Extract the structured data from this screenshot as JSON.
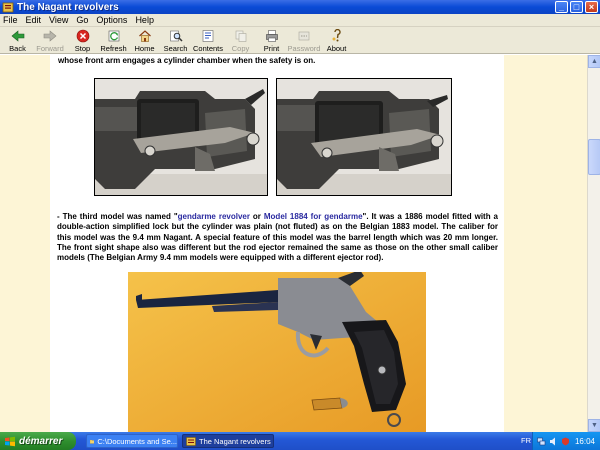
{
  "window": {
    "title": "The Nagant revolvers"
  },
  "menu": [
    "File",
    "Edit",
    "View",
    "Go",
    "Options",
    "Help"
  ],
  "toolbar": [
    {
      "label": "Back",
      "icon": "back-arrow-icon",
      "enabled": true
    },
    {
      "label": "Forward",
      "icon": "forward-arrow-icon",
      "enabled": false
    },
    {
      "label": "Stop",
      "icon": "stop-icon",
      "enabled": true
    },
    {
      "label": "Refresh",
      "icon": "refresh-icon",
      "enabled": true
    },
    {
      "label": "Home",
      "icon": "home-icon",
      "enabled": true
    },
    {
      "label": "Search",
      "icon": "search-icon",
      "enabled": true
    },
    {
      "label": "Contents",
      "icon": "contents-icon",
      "enabled": true
    },
    {
      "label": "Copy",
      "icon": "copy-icon",
      "enabled": false
    },
    {
      "label": "Print",
      "icon": "print-icon",
      "enabled": true
    },
    {
      "label": "Password",
      "icon": "password-icon",
      "enabled": false
    },
    {
      "label": "About",
      "icon": "about-icon",
      "enabled": true
    }
  ],
  "content": {
    "top_text": "whose front arm engages a cylinder chamber when the safety is on.",
    "para_prefix": "- The third model was named \"",
    "para_hl1": "gendarme revolver",
    "para_mid": " or ",
    "para_hl2": "Model 1884 for gendarme",
    "para_rest": "\". It was a 1886 model fitted with a double-action simplified lock but the cylinder was plain (not fluted) as on the Belgian 1883 model. The caliber for this model was the 9.4 mm Nagant. A special feature of this model was the barrel length which was 20 mm longer. The front sight shape also was different but the rod ejector remained the same as those on the other small caliber models (The Belgian Army 9.4 mm models were equipped with a different ejector rod)."
  },
  "taskbar": {
    "start_label": "démarrer",
    "tasks": [
      {
        "label": "C:\\Documents and Se...",
        "icon": "folder-icon"
      },
      {
        "label": "The Nagant revolvers",
        "icon": "help-book-icon"
      }
    ],
    "lang": "FR",
    "clock": "16:04"
  },
  "colors": {
    "page_margin": "#fdf5d6",
    "highlight_text": "#2a2aa0",
    "photo_bg": "#f2b43a"
  }
}
